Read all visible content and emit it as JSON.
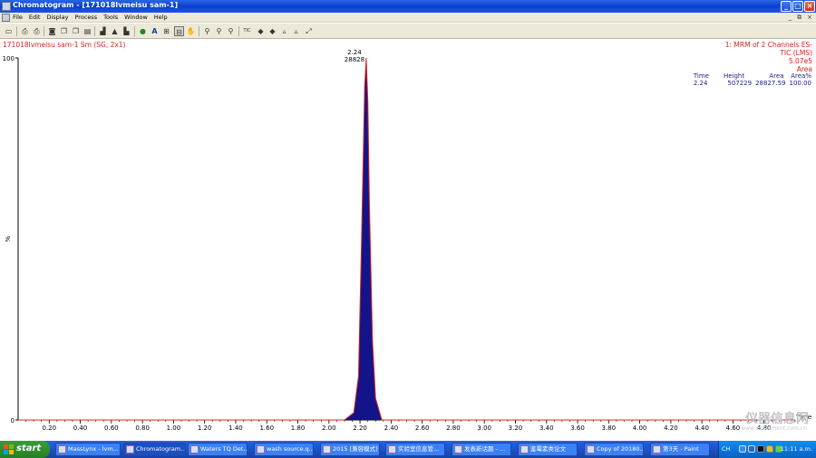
{
  "window": {
    "title": "Chromatogram - [171018lvmeisu sam-1]",
    "buttons": {
      "minimize": "_",
      "maximize": "□",
      "close": "×"
    }
  },
  "menu": {
    "items": [
      "File",
      "Edit",
      "Display",
      "Process",
      "Tools",
      "Window",
      "Help"
    ],
    "mdi_buttons": [
      "_",
      "⧉",
      "×"
    ]
  },
  "toolbar": {
    "tic_label": "TIC"
  },
  "chart": {
    "trace_name": "171018lvmeisu sam-1 Sm (SG, 2x1)",
    "header_line1": "1: MRM of 2 Channels ES-",
    "header_line2": "TIC (LMS)",
    "header_line3": "5.07e5",
    "header_line4": "Area",
    "peak_table": {
      "headers": [
        "Time",
        "Height",
        "Area",
        "Area%"
      ],
      "rows": [
        [
          "2.24",
          "507229",
          "28827.59",
          "100.00"
        ]
      ]
    },
    "peak_label_time": "2.24",
    "peak_label_area": "28828",
    "y_tick_top": "100",
    "y_tick_bottom": "0",
    "y_axis_label": "%",
    "x_axis_label": "Time"
  },
  "chart_data": {
    "type": "line",
    "xlabel": "Time",
    "ylabel": "%",
    "xlim": [
      0.0,
      5.0
    ],
    "ylim": [
      0,
      100
    ],
    "x_ticks": [
      "0.20",
      "0.40",
      "0.60",
      "0.80",
      "1.00",
      "1.20",
      "1.40",
      "1.60",
      "1.80",
      "2.00",
      "2.20",
      "2.40",
      "2.60",
      "2.80",
      "3.00",
      "3.20",
      "3.40",
      "3.60",
      "3.80",
      "4.00",
      "4.20",
      "4.40",
      "4.60",
      "4.80"
    ],
    "series": [
      {
        "x": [
          0.0,
          2.1,
          2.16,
          2.19,
          2.21,
          2.23,
          2.24,
          2.25,
          2.26,
          2.28,
          2.3,
          2.34,
          5.0
        ],
        "y": [
          0,
          0,
          2,
          12,
          50,
          92,
          100,
          88,
          60,
          22,
          6,
          0,
          0
        ]
      }
    ],
    "fill_color": "#14148a",
    "line_color": "#d8241a"
  },
  "taskbar": {
    "start_label": "start",
    "tasks": [
      "MassLynx - lvm...",
      "Chromatogram...",
      "Waters TQ Det...",
      "wash source.q...",
      "2015 [兼容模式]",
      "实验室信息管...",
      "发表新话题 - ...",
      "鉴霉素类论文",
      "Copy of 20180...",
      "第3天 - Paint"
    ],
    "active_task_index": 1,
    "tray_lang": "CH",
    "clock": "11:11 a.m."
  },
  "watermark": {
    "text": "仪器信息网",
    "sub": "www.instrument.com.cn"
  }
}
